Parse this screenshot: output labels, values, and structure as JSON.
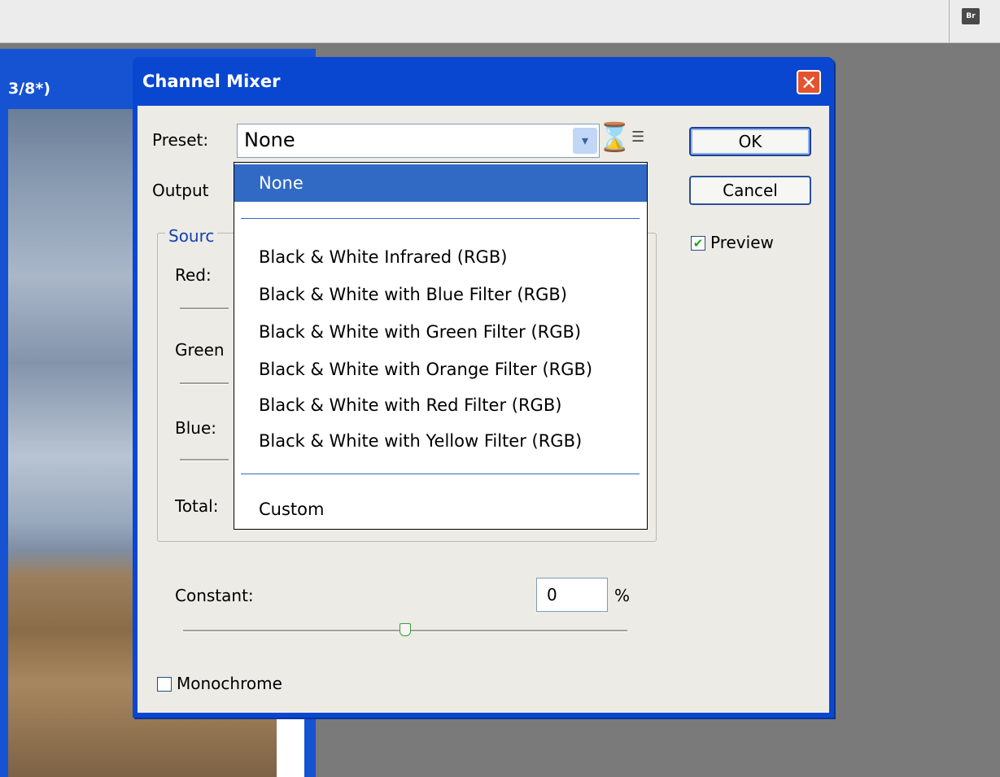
{
  "app_bar": {
    "bridge_icon_label": "Br"
  },
  "document": {
    "title_fragment": "3/8*)"
  },
  "dialog": {
    "title": "Channel Mixer",
    "close_glyph": "✕",
    "preset_label": "Preset:",
    "preset_value": "None",
    "output_label": "Output",
    "source_legend": "Sourc",
    "red_label": "Red:",
    "green_label": "Green",
    "blue_label": "Blue:",
    "total_label": "Total:",
    "constant_label": "Constant:",
    "constant_value": "0",
    "constant_unit": "%",
    "monochrome_label": "Monochrome",
    "monochrome_checked": false,
    "preview_label": "Preview",
    "preview_checked": true,
    "ok_label": "OK",
    "cancel_label": "Cancel",
    "constant_slider_level_percent": 0
  },
  "dropdown": {
    "items": [
      {
        "label": "None",
        "selected": true
      },
      {
        "label": "Black & White Infrared (RGB)"
      },
      {
        "label": "Black & White with Blue Filter (RGB)"
      },
      {
        "label": "Black & White with Green Filter (RGB)"
      },
      {
        "label": "Black & White with Orange Filter (RGB)"
      },
      {
        "label": "Black & White with Red Filter (RGB)"
      },
      {
        "label": "Black & White with Yellow Filter (RGB)"
      },
      {
        "label": "Custom"
      }
    ]
  },
  "icons": {
    "hourglass": "hourglass-cursor-icon",
    "preset_options": "preset-options-icon",
    "combo_arrow": "chevron-down-icon",
    "checkmark": "✔"
  },
  "colors": {
    "title_bar": "#0a47d0",
    "selection": "#316ac5",
    "dialog_bg": "#ecebe5"
  }
}
